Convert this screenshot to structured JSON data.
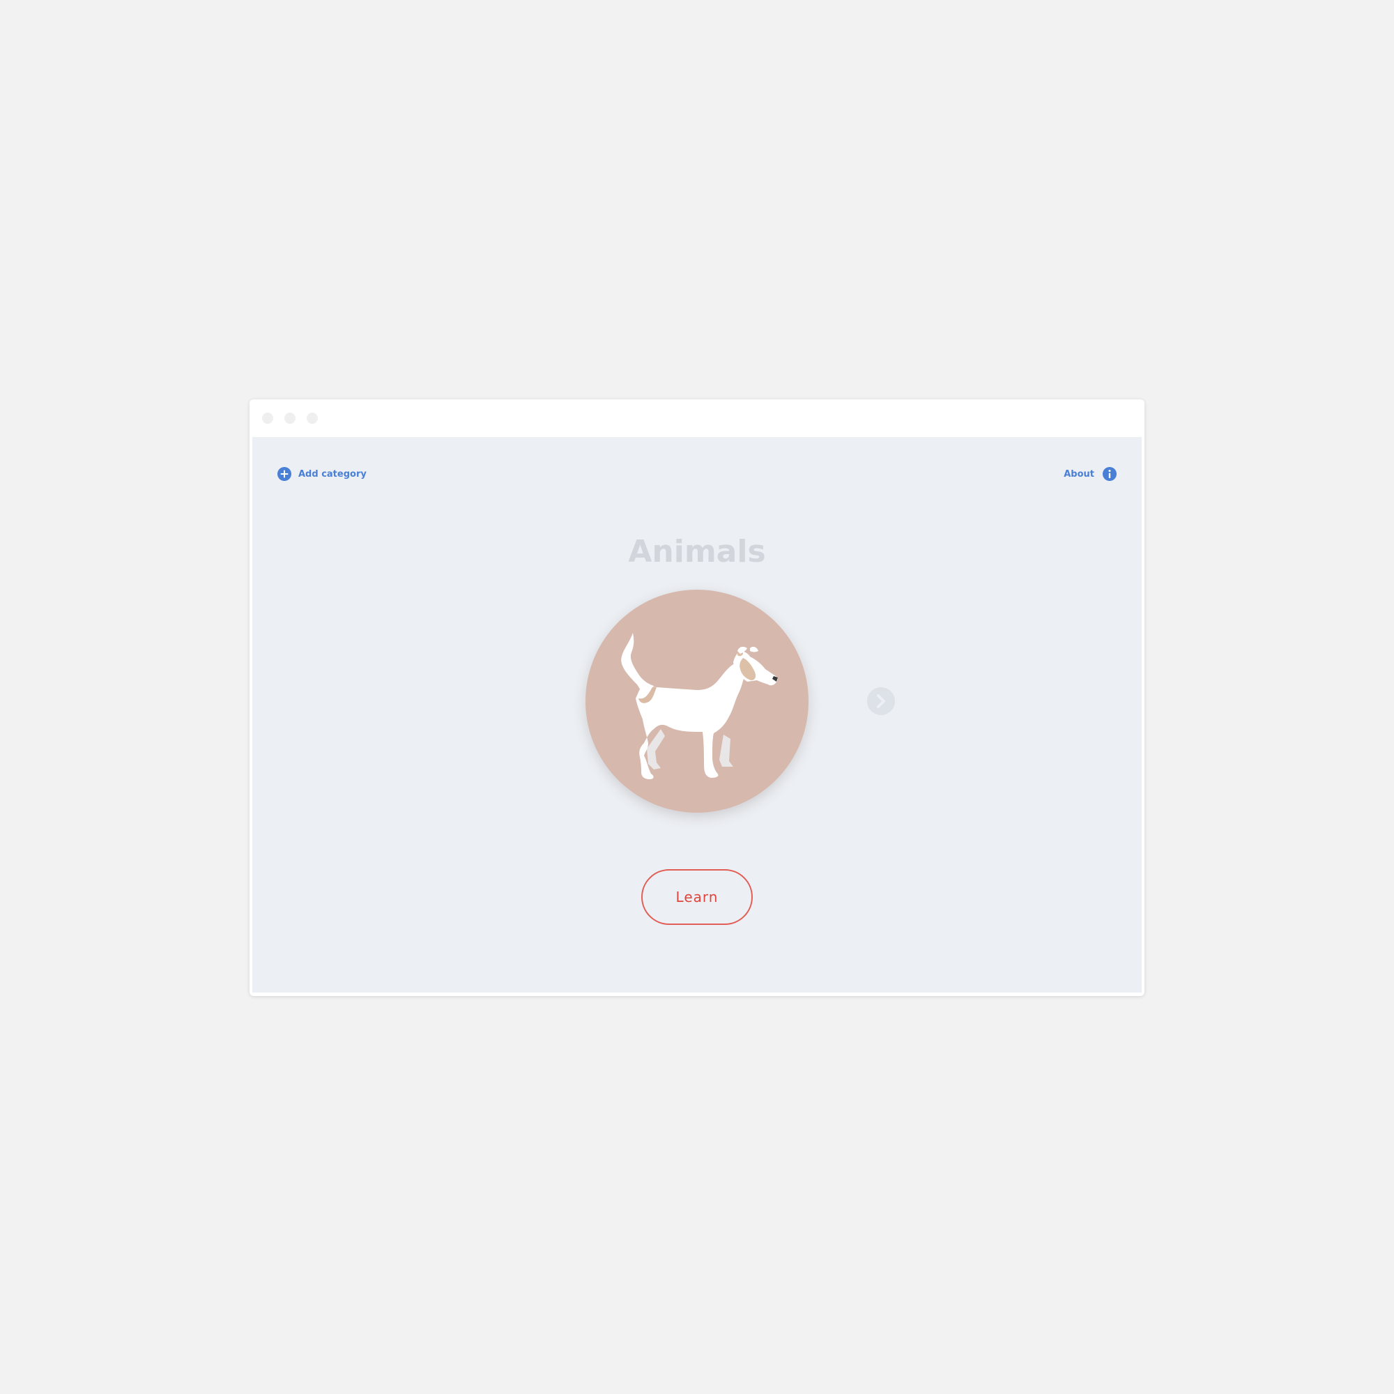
{
  "window": {
    "controls": [
      "close",
      "minimize",
      "maximize"
    ]
  },
  "toolbar": {
    "add_category_label": "Add category",
    "add_category_icon": "plus-circle-icon",
    "about_label": "About",
    "about_icon": "info-circle-icon"
  },
  "category": {
    "title": "Animals",
    "image": "dog-illustration",
    "next_icon": "chevron-right-icon"
  },
  "actions": {
    "learn_label": "Learn"
  },
  "colors": {
    "accent_blue": "#4a7fd6",
    "learn_red": "#e0453d",
    "circle_bg": "#d6b8ad",
    "content_bg": "#eceff3",
    "page_bg": "#f2f2f2"
  }
}
